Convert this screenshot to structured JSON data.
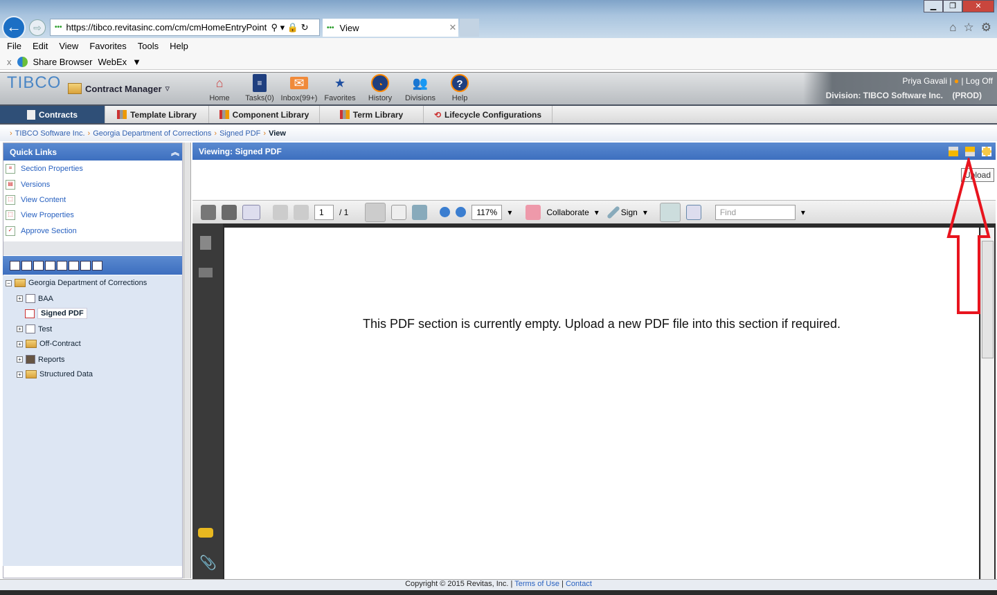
{
  "browser": {
    "url": "https://tibco.revitasinc.com/cm/cmHomeEntryPoint.dc",
    "tab_title": "View",
    "menu": [
      "File",
      "Edit",
      "View",
      "Favorites",
      "Tools",
      "Help"
    ],
    "favorites": [
      "Share Browser",
      "WebEx"
    ]
  },
  "app": {
    "logo": "TIBCO",
    "module": "Contract Manager",
    "nav": [
      {
        "label": "Home",
        "icon": "home-icon"
      },
      {
        "label": "Tasks(0)",
        "icon": "tasks-icon"
      },
      {
        "label": "Inbox(99+)",
        "icon": "inbox-icon"
      },
      {
        "label": "Favorites",
        "icon": "star-icon"
      },
      {
        "label": "History",
        "icon": "history-icon"
      },
      {
        "label": "Divisions",
        "icon": "divisions-icon"
      },
      {
        "label": "Help",
        "icon": "help-icon"
      }
    ],
    "user": "Priya Gavali",
    "logoff": "Log Off",
    "division": "Division: TIBCO Software Inc.    (PROD)"
  },
  "tabs": [
    "Contracts",
    "Template Library",
    "Component Library",
    "Term Library",
    "Lifecycle Configurations"
  ],
  "breadcrumb": [
    "TIBCO Software Inc.",
    "Georgia Department of Corrections",
    "Signed PDF",
    "View"
  ],
  "quick_links": {
    "title": "Quick Links",
    "items": [
      "Section Properties",
      "Versions",
      "View Content",
      "View Properties",
      "Approve Section"
    ]
  },
  "tree": {
    "root": "Georgia Department of Corrections",
    "children": [
      "BAA",
      "Signed PDF",
      "Test",
      "Off-Contract",
      "Reports",
      "Structured Data"
    ]
  },
  "viewer": {
    "title": "Viewing: Signed PDF",
    "tooltip": "Upload",
    "page": "1",
    "page_total": "/ 1",
    "zoom": "117%",
    "collaborate": "Collaborate",
    "sign": "Sign",
    "find_placeholder": "Find",
    "message": "This PDF section is currently empty.  Upload a new PDF file into this section if required."
  },
  "footer": {
    "copyright": "Copyright © 2015 Revitas, Inc.",
    "terms": "Terms of Use",
    "contact": "Contact"
  },
  "colors": {
    "accent": "#3d6fbf",
    "annotation": "#e8141e"
  }
}
